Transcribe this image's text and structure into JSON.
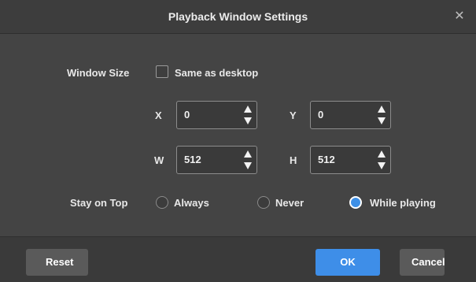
{
  "dialog": {
    "title": "Playback Window Settings",
    "close_glyph": "✕"
  },
  "window_size": {
    "label": "Window Size",
    "same_as_desktop": {
      "label": "Same as desktop",
      "checked": false
    },
    "x": {
      "label": "X",
      "value": "0"
    },
    "y": {
      "label": "Y",
      "value": "0"
    },
    "w": {
      "label": "W",
      "value": "512"
    },
    "h": {
      "label": "H",
      "value": "512"
    }
  },
  "stay_on_top": {
    "label": "Stay on Top",
    "options": [
      {
        "label": "Always",
        "selected": false
      },
      {
        "label": "Never",
        "selected": false
      },
      {
        "label": "While playing",
        "selected": true
      }
    ]
  },
  "footer": {
    "reset_label": "Reset",
    "ok_label": "OK",
    "cancel_label": "Cancel"
  },
  "colors": {
    "accent": "#3e8ee8",
    "body_bg": "#444444",
    "titlebar_bg": "#3d3d3d"
  }
}
